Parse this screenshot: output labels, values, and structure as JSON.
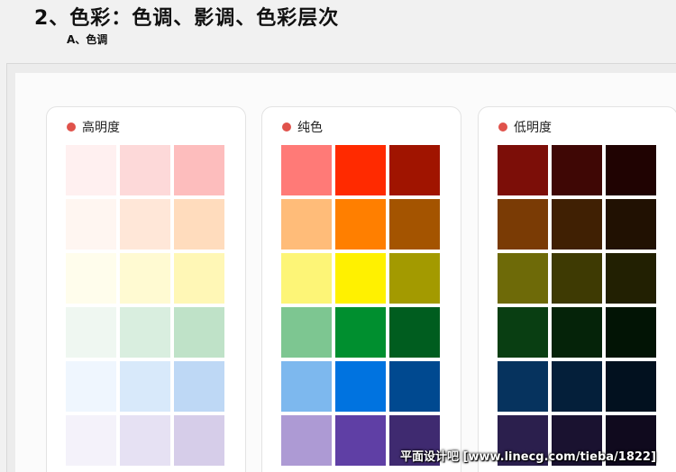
{
  "heading": "2、色彩：色调、影调、色彩层次",
  "subheading": "A、色调",
  "accent_color": "#e0524b",
  "cards": [
    {
      "title": "高明度",
      "swatches": [
        "#fff0f0",
        "#fdd9d9",
        "#fdbdbd",
        "#fff6f1",
        "#ffe7d8",
        "#ffdcbd",
        "#fffdec",
        "#fffad2",
        "#fff7b6",
        "#eff7f1",
        "#d9eedf",
        "#bfe2c8",
        "#eff6fe",
        "#d8e9fa",
        "#bed8f5",
        "#f4f2fa",
        "#e6e1f3",
        "#d6cde9"
      ]
    },
    {
      "title": "纯色",
      "swatches": [
        "#ff7a77",
        "#ff2a00",
        "#a01400",
        "#ffbc79",
        "#ff7f00",
        "#a45400",
        "#fdf577",
        "#fff100",
        "#a39a00",
        "#7dc691",
        "#008f2f",
        "#005d1f",
        "#7db8ee",
        "#0073e0",
        "#004990",
        "#ad9ad4",
        "#5f3fa5",
        "#3f2a70"
      ]
    },
    {
      "title": "低明度",
      "swatches": [
        "#7c0e08",
        "#3f0705",
        "#200302",
        "#7a3b05",
        "#402003",
        "#211102",
        "#6e6a08",
        "#3e3a03",
        "#222002",
        "#093e12",
        "#052309",
        "#021405",
        "#06335e",
        "#041f3a",
        "#02111f",
        "#2b1f4d",
        "#1a1230",
        "#100a1e"
      ]
    }
  ],
  "watermark": "平面设计吧 [www.linecg.com/tieba/1822]"
}
